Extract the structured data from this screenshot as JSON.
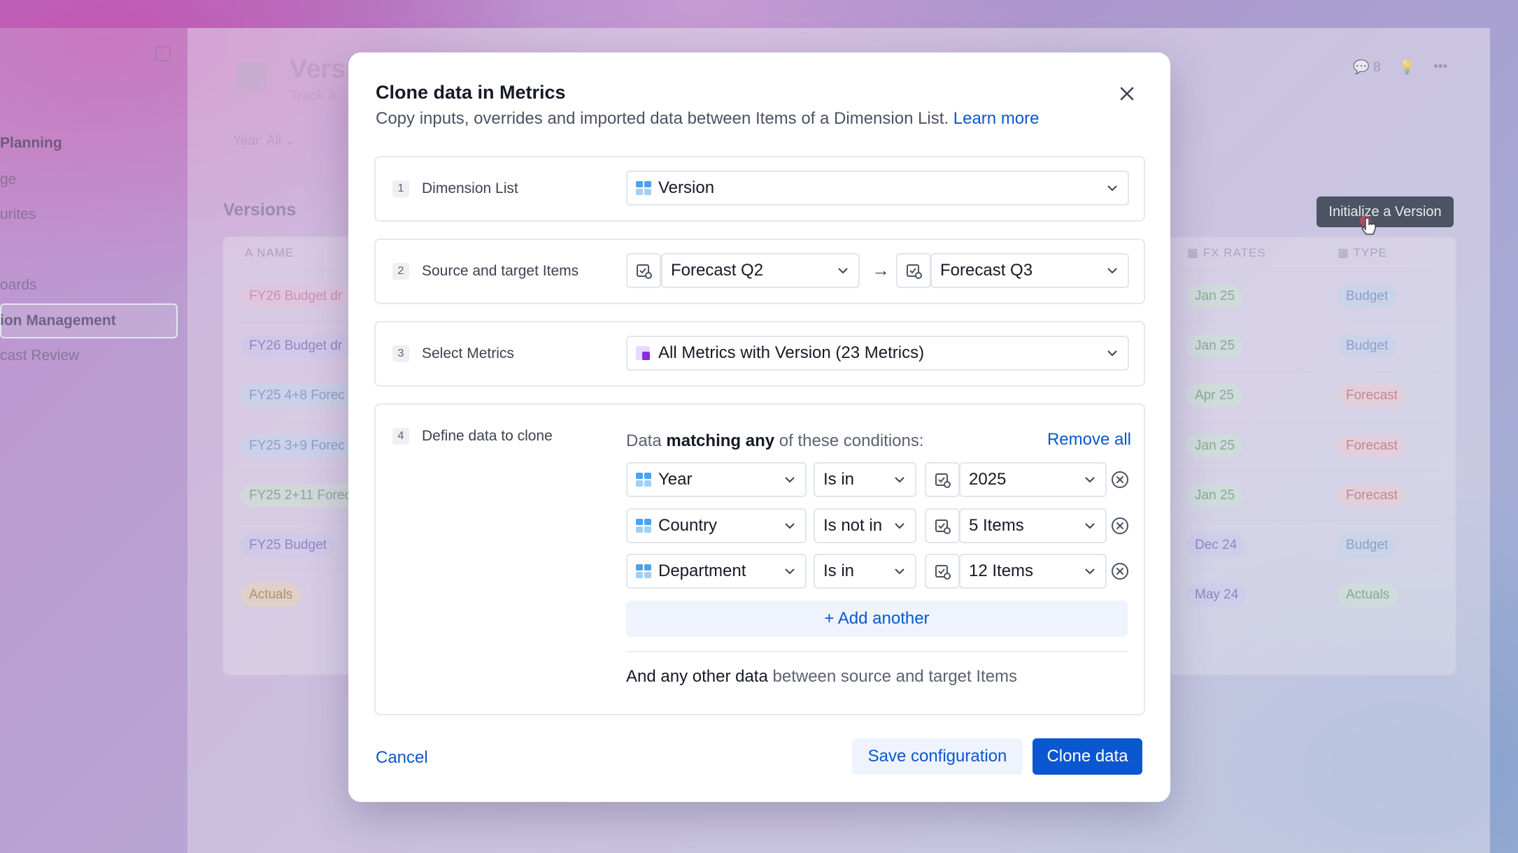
{
  "background": {
    "sidebar": {
      "items": [
        "Planning",
        "ge",
        "urites",
        "oards",
        "ion Management",
        "cast Review"
      ]
    },
    "page": {
      "title": "Versi",
      "subtitle": "Track a",
      "year_filter": "Year: All",
      "section_title": "Versions",
      "comments_count": "8"
    },
    "table": {
      "headers": {
        "name": "NAME",
        "fx_rates": "FX RATES",
        "type": "TYPE"
      },
      "rows": [
        {
          "name": "FY26 Budget dr",
          "fx": "Jan 25",
          "type": "Budget"
        },
        {
          "name": "FY26 Budget dr",
          "fx": "Jan 25",
          "type": "Budget"
        },
        {
          "name": "FY25 4+8 Forec",
          "fx": "Apr 25",
          "type": "Forecast"
        },
        {
          "name": "FY25 3+9 Forec",
          "fx": "Jan 25",
          "type": "Forecast"
        },
        {
          "name": "FY25 2+11 Forec",
          "fx": "Jan 25",
          "type": "Forecast"
        },
        {
          "name": "FY25 Budget",
          "fx": "Dec 24",
          "type": "Budget"
        },
        {
          "name": "Actuals",
          "fx": "May 24",
          "type": "Actuals"
        }
      ]
    },
    "tooltip": "Initialize a Version"
  },
  "modal": {
    "title": "Clone data in Metrics",
    "description": "Copy inputs, overrides and imported data between Items of a Dimension List.",
    "learn_more": "Learn more",
    "sections": {
      "s1": {
        "step": "1",
        "label": "Dimension List",
        "value": "Version"
      },
      "s2": {
        "step": "2",
        "label": "Source and target Items",
        "source": "Forecast Q2",
        "arrow": "→",
        "target": "Forecast Q3"
      },
      "s3": {
        "step": "3",
        "label": "Select Metrics",
        "value": "All Metrics with Version (23 Metrics)"
      },
      "s4": {
        "step": "4",
        "label": "Define data to clone",
        "head_pre": "Data ",
        "head_bold": "matching any",
        "head_post": " of these conditions:",
        "remove_all": "Remove all",
        "conditions": [
          {
            "dimension": "Year",
            "operator": "Is in",
            "value": "2025"
          },
          {
            "dimension": "Country",
            "operator": "Is not in",
            "value": "5 Items"
          },
          {
            "dimension": "Department",
            "operator": "Is in",
            "value": "12 Items"
          }
        ],
        "add_another": "Add another",
        "other_bold": "And any other data",
        "other_rest": " between source and target Items"
      }
    },
    "footer": {
      "cancel": "Cancel",
      "save": "Save configuration",
      "clone": "Clone data"
    }
  },
  "colors": {
    "accent": "#0b57d0",
    "tooltip_bg": "#3d4556"
  }
}
